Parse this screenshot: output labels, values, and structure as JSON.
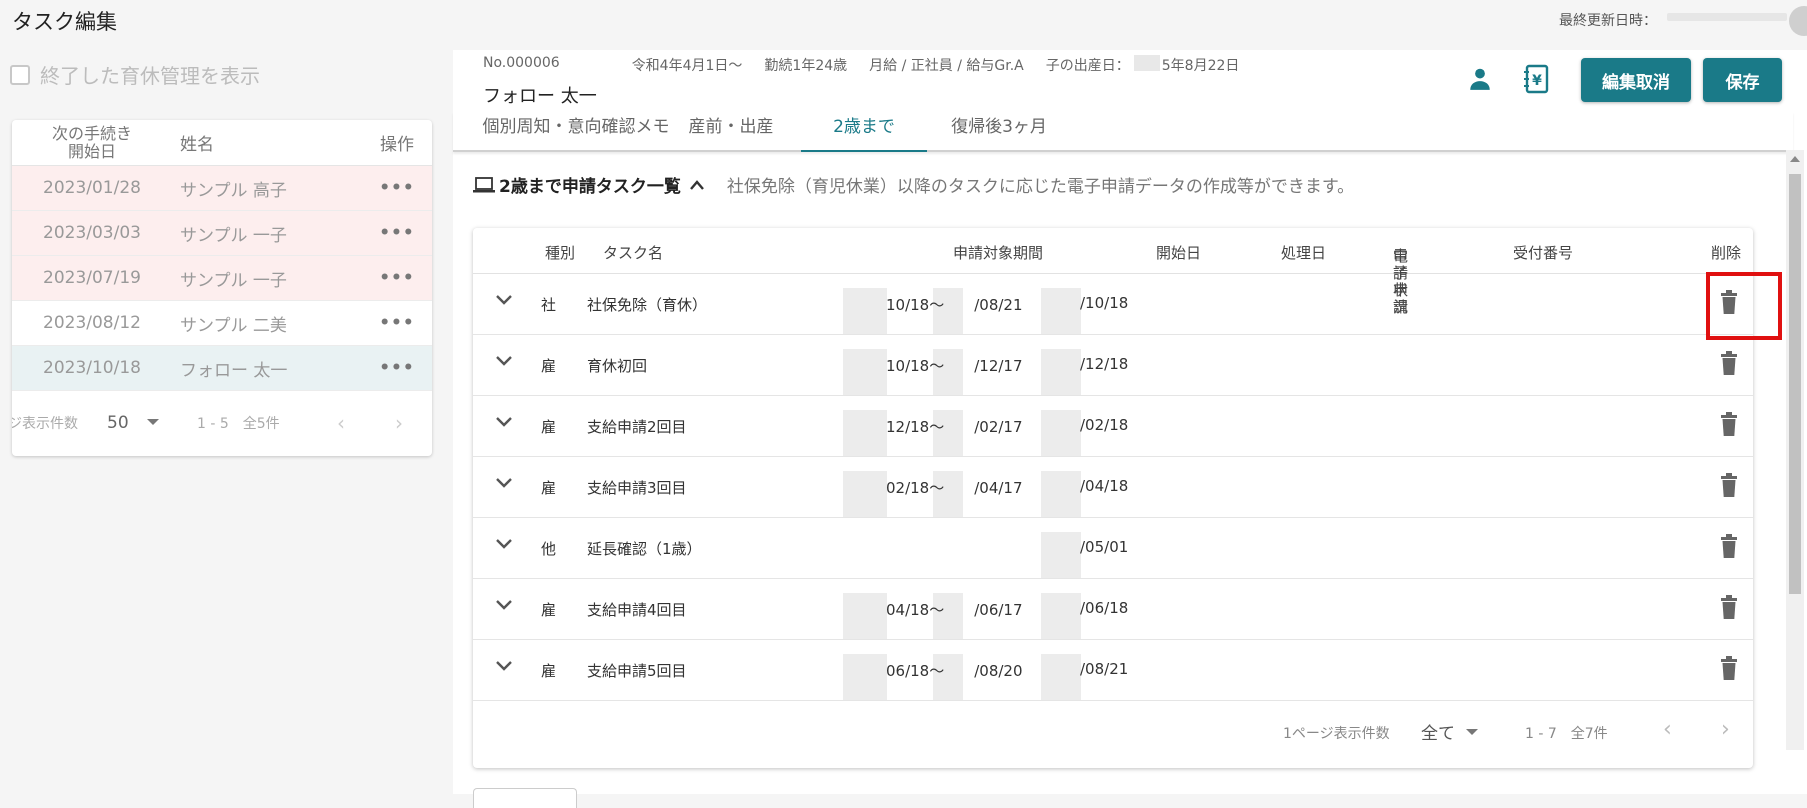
{
  "header": {
    "title": "タスク編集",
    "last_updated_label": "最終更新日時："
  },
  "left": {
    "filter_label": "終了した育休管理を表示",
    "columns": [
      "次の手続き\n開始日",
      "姓名",
      "操作"
    ],
    "col_date_line1": "次の手続き",
    "col_date_line2": "開始日",
    "col_name": "姓名",
    "col_action": "操作",
    "rows": [
      {
        "date": "2023/01/28",
        "name": "サンプル 高子",
        "action": "•••"
      },
      {
        "date": "2023/03/03",
        "name": "サンプル 一子",
        "action": "•••"
      },
      {
        "date": "2023/07/19",
        "name": "サンプル 一子",
        "action": "•••"
      },
      {
        "date": "2023/08/12",
        "name": "サンプル 二美",
        "action": "•••"
      },
      {
        "date": "2023/10/18",
        "name": "フォロー 太一",
        "action": "•••"
      }
    ],
    "per_page_label": "ジ表示件数",
    "per_page_value": "50",
    "range_text": "1 - 5　全5件",
    "prev": "‹",
    "next": "›"
  },
  "employee": {
    "number": "No.000006",
    "start": "令和4年4月1日～",
    "tenure": "勤続1年24歳",
    "pay": "月給 / 正社員 / 給与Gr.A",
    "birth_label": "子の出産日：",
    "birth_date": "5年8月22日",
    "name": "フォロー 太一"
  },
  "actions": {
    "cancel": "編集取消",
    "save": "保存"
  },
  "tabs": [
    "個別周知・意向確認メモ",
    "産前・出産",
    "2歳まで",
    "復帰後3ヶ月"
  ],
  "section": {
    "title": "2歳まで申請タスク一覧",
    "desc": "社保免除（育児休業）以降のタスクに応じた電子申請データの作成等ができます。"
  },
  "table": {
    "headers": {
      "type": "種別",
      "task": "タスク名",
      "period": "申請対象期間",
      "start": "開始日",
      "processed": "処理日",
      "status1": "電子申請",
      "status2": "申請状況",
      "receipt": "受付番号",
      "delete": "削除"
    },
    "rows": [
      {
        "type": "社",
        "task": "社保免除（育休）",
        "period": "10/18～　　/08/21",
        "start": "/10/18"
      },
      {
        "type": "雇",
        "task": "育休初回",
        "period": "10/18～　　/12/17",
        "start": "/12/18"
      },
      {
        "type": "雇",
        "task": "支給申請2回目",
        "period": "12/18～　　/02/17",
        "start": "/02/18"
      },
      {
        "type": "雇",
        "task": "支給申請3回目",
        "period": "02/18～　　/04/17",
        "start": "/04/18"
      },
      {
        "type": "他",
        "task": "延長確認（1歳）",
        "period": "",
        "start": "/05/01"
      },
      {
        "type": "雇",
        "task": "支給申請4回目",
        "period": "04/18～　　/06/17",
        "start": "/06/18"
      },
      {
        "type": "雇",
        "task": "支給申請5回目",
        "period": "06/18～　　/08/20",
        "start": "/08/21"
      }
    ],
    "per_page_label": "1ページ表示件数",
    "per_page_value": "全て",
    "range_text": "1 - 7　全7件",
    "prev": "‹",
    "next": "›"
  },
  "colors": {
    "accent": "#1a7a88",
    "highlight": "#e01010",
    "warn_row": "#fdeeee",
    "selected_row": "#e9f2f3"
  }
}
